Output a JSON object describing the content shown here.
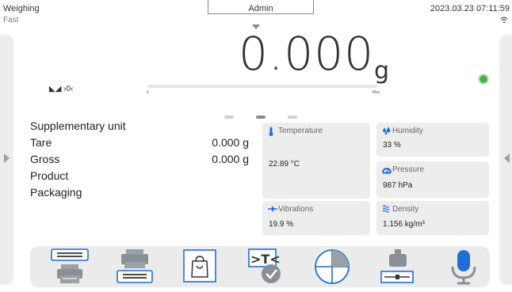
{
  "status_bar": {
    "mode": "Weighing",
    "submode": "Fast",
    "user": "Admin",
    "datetime": "2023.03.23 07:11:59"
  },
  "weighing": {
    "value": "0.000",
    "unit": "g",
    "indicators": "◣◢ ›0‹",
    "range_min": "0",
    "range_max": "Max",
    "range_fill": 0
  },
  "info": {
    "rows": [
      {
        "label": "Supplementary unit",
        "value": ""
      },
      {
        "label": "Tare",
        "value": "0.000 g"
      },
      {
        "label": "Gross",
        "value": "0.000 g"
      },
      {
        "label": "Product",
        "value": ""
      },
      {
        "label": "Packaging",
        "value": ""
      }
    ]
  },
  "tiles": {
    "temperature": {
      "title": "Temperature",
      "value": "22.89 °C"
    },
    "humidity": {
      "title": "Humidity",
      "value": "33 %"
    },
    "pressure": {
      "title": "Pressure",
      "value": "987 hPa"
    },
    "vibrations": {
      "title": "Vibrations",
      "value": "19.9 %"
    },
    "density": {
      "title": "Density",
      "value": "1.156 kg/m³"
    }
  },
  "pager": {
    "pages": 3,
    "active": 1
  },
  "colors": {
    "accent": "#1f6fd6",
    "stable": "#4caf50",
    "tile_bg": "#ededed",
    "icon_gray": "#8a8f96"
  },
  "function_keys": [
    "print-header-icon",
    "print-footer-icon",
    "packaging-icon",
    "tare-confirm-icon",
    "product-database-icon",
    "density-icon",
    "microphone-icon"
  ]
}
